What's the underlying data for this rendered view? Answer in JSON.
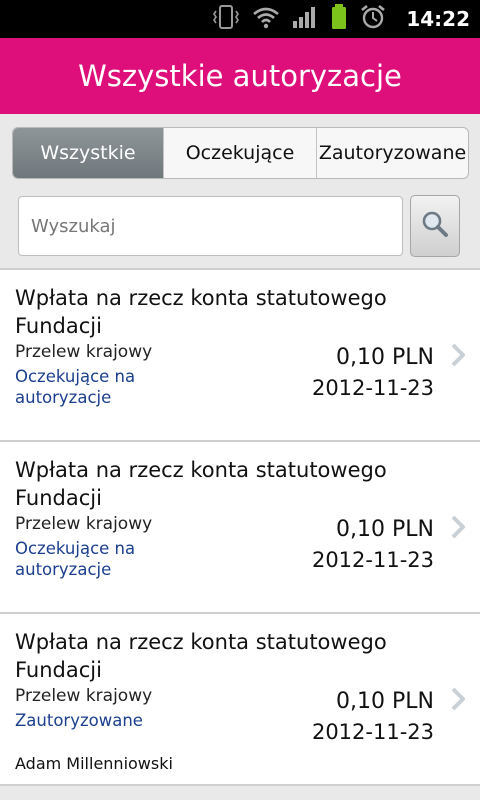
{
  "status_bar": {
    "time": "14:22",
    "icons": [
      "vibrate-icon",
      "wifi-icon",
      "signal-icon",
      "battery-icon",
      "alarm-icon"
    ],
    "battery_color": "#7cc41b"
  },
  "header": {
    "title": "Wszystkie autoryzacje",
    "color": "#de0f7b"
  },
  "tabs": [
    {
      "label": "Wszystkie",
      "active": true
    },
    {
      "label": "Oczekujące",
      "active": false
    },
    {
      "label": "Zautoryzowane",
      "active": false
    }
  ],
  "search": {
    "placeholder": "Wyszukaj",
    "value": ""
  },
  "items": [
    {
      "title": "Wpłata na rzecz konta statutowego Fundacji",
      "type": "Przelew krajowy",
      "status": "Oczekujące na autoryzacje",
      "person": "",
      "amount": "0,10 PLN",
      "date": "2012-11-23"
    },
    {
      "title": "Wpłata na rzecz konta statutowego Fundacji",
      "type": "Przelew krajowy",
      "status": "Oczekujące na autoryzacje",
      "person": "",
      "amount": "0,10 PLN",
      "date": "2012-11-23"
    },
    {
      "title": "Wpłata na rzecz konta statutowego Fundacji",
      "type": "Przelew krajowy",
      "status": "Zautoryzowane",
      "person": "Adam Millenniowski",
      "amount": "0,10 PLN",
      "date": "2012-11-23"
    }
  ]
}
